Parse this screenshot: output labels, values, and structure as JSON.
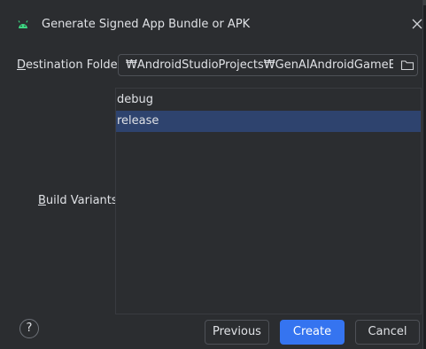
{
  "dialog": {
    "title": "Generate Signed App Bundle or APK",
    "app_icon": "android-icon",
    "close_icon": "close-icon"
  },
  "destination": {
    "label_mnemonic": "D",
    "label_rest": "estination Folder:",
    "value": "₩AndroidStudioProjects₩GenAIAndroidGameExam₩app",
    "browse_icon": "folder-icon"
  },
  "build_variants": {
    "label_mnemonic": "B",
    "label_rest": "uild Variants:",
    "items": [
      {
        "label": "debug",
        "selected": false
      },
      {
        "label": "release",
        "selected": true
      }
    ]
  },
  "footer": {
    "help_label": "?",
    "previous_label": "Previous",
    "create_label": "Create",
    "cancel_label": "Cancel"
  },
  "colors": {
    "background": "#2b2d30",
    "selection": "#2e436e",
    "primary": "#3574f0",
    "android_green": "#3ddc84"
  }
}
